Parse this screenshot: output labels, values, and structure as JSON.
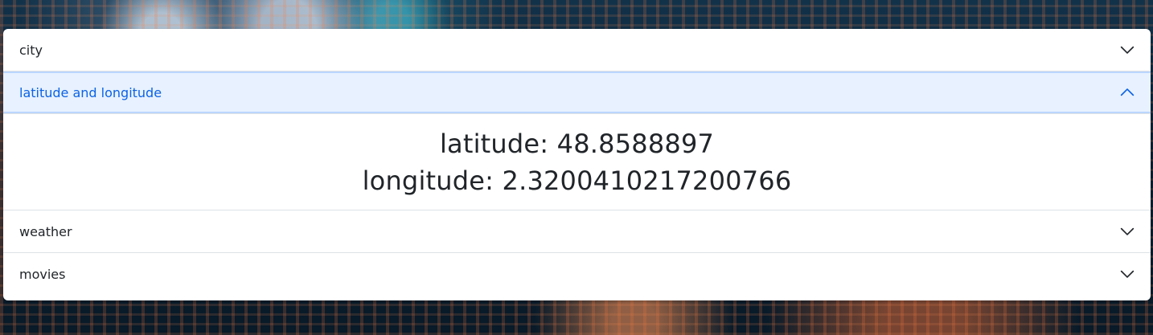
{
  "accordion": {
    "items": [
      {
        "label": "city",
        "expanded": false,
        "chevron_icon": "chevron-down-icon"
      },
      {
        "label": "latitude and longitude",
        "expanded": true,
        "chevron_icon": "chevron-up-icon"
      },
      {
        "label": "weather",
        "expanded": false,
        "chevron_icon": "chevron-down-icon"
      },
      {
        "label": "movies",
        "expanded": false,
        "chevron_icon": "chevron-down-icon"
      }
    ],
    "coordinates": {
      "latitude_text": "latitude: 48.8588897",
      "longitude_text": "longitude: 2.3200410217200766"
    }
  },
  "colors": {
    "accent": "#0c63e4",
    "active_header_bg": "#e7f1ff",
    "text": "#212529",
    "panel_bg": "#ffffff"
  }
}
